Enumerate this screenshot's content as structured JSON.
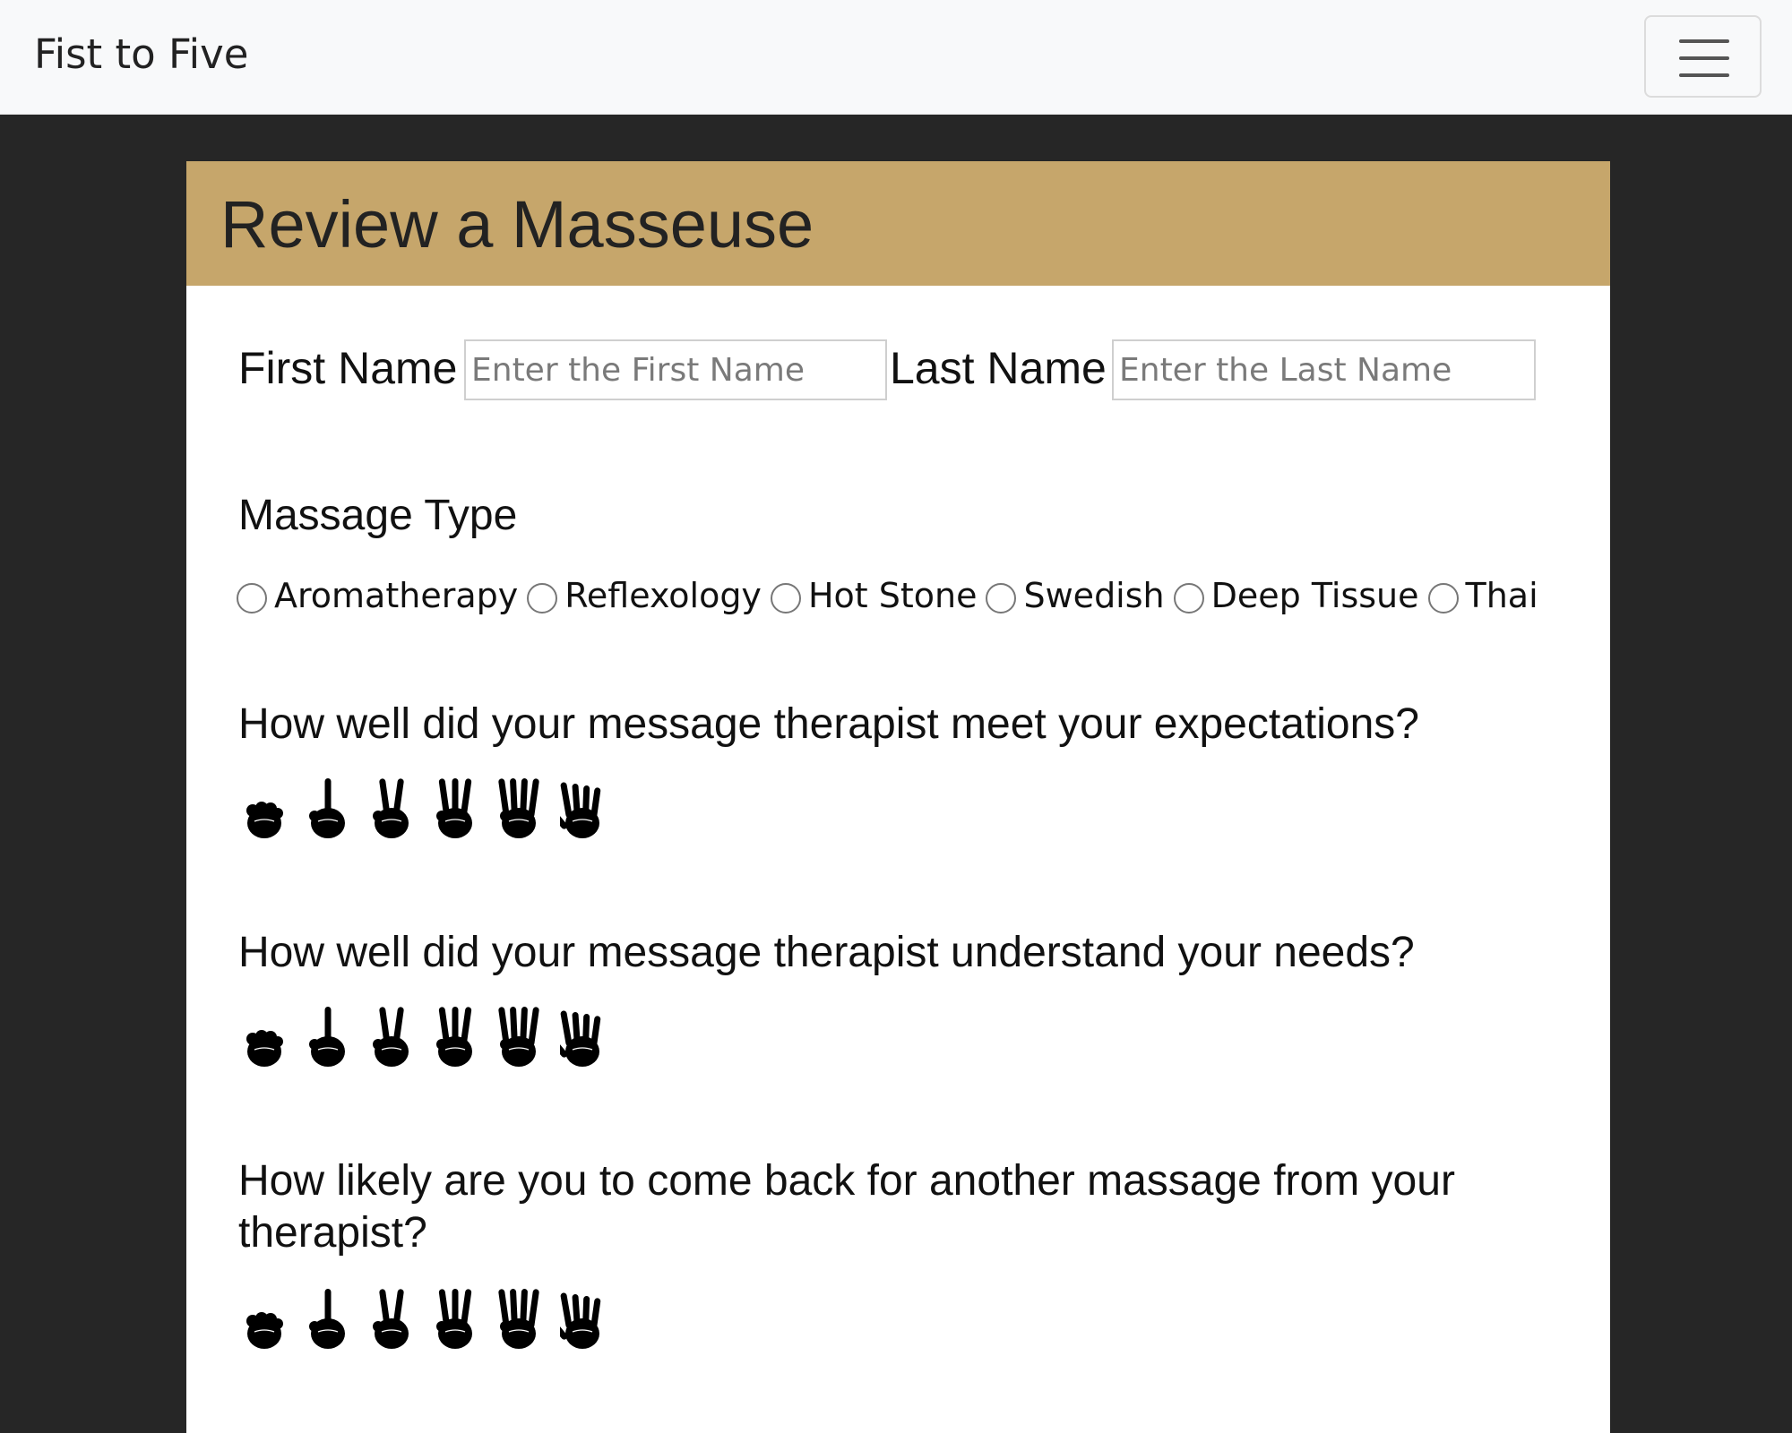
{
  "navbar": {
    "brand": "Fist to Five",
    "menu_icon": "hamburger-menu-icon"
  },
  "card": {
    "title": "Review a Masseuse",
    "first_name_label": "First Name",
    "first_name_placeholder": "Enter the First Name",
    "last_name_label": "Last Name",
    "last_name_placeholder": "Enter the Last Name",
    "massage_type_label": "Massage Type",
    "massage_types": [
      "Aromatherapy",
      "Reflexology",
      "Hot Stone",
      "Swedish",
      "Deep Tissue",
      "Thai"
    ],
    "questions": [
      "How well did your message therapist meet your expectations?",
      "How well did your message therapist understand your needs?",
      "How likely are you to come back for another massage from your therapist?"
    ],
    "rating_icons": [
      "fist-icon",
      "one-finger-icon",
      "two-fingers-icon",
      "three-fingers-icon",
      "four-fingers-icon",
      "five-fingers-icon"
    ]
  },
  "colors": {
    "header": "#c6a66b",
    "page_background": "#262626",
    "navbar": "#f8f9fa"
  }
}
